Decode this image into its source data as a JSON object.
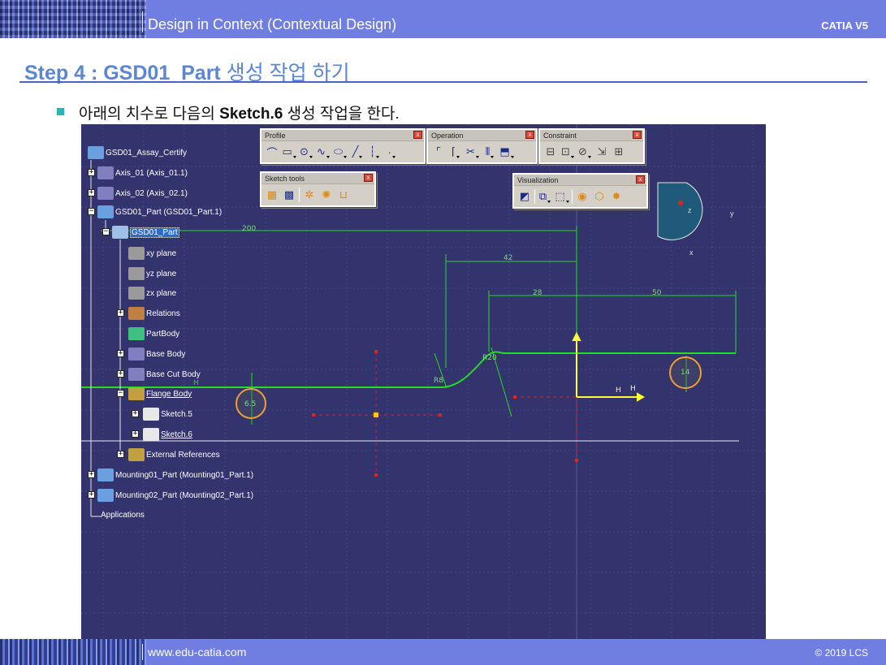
{
  "header": {
    "title": "Design in Context (Contextual Design)",
    "brand": "CATIA V5"
  },
  "step": {
    "prefix": "Step 4 : GSD01_Part ",
    "suffix": "생성 작업 하기"
  },
  "bullet": {
    "text_before": "아래의 치수로 다음의 ",
    "bold": "Sketch.6",
    "text_after": " 생성 작업을 한다."
  },
  "tree": {
    "items": [
      {
        "label": "GSD01_Assay_Certify",
        "icon": "product-icon"
      },
      {
        "label": "Axis_01 (Axis_01.1)",
        "icon": "part-instance-icon"
      },
      {
        "label": "Axis_02 (Axis_02.1)",
        "icon": "part-instance-icon"
      },
      {
        "label": "GSD01_Part (GSD01_Part.1)",
        "icon": "part-instance-icon"
      },
      {
        "label": "GSD01_Part",
        "icon": "part-icon",
        "selected": true
      },
      {
        "label": "xy plane",
        "icon": "plane-icon"
      },
      {
        "label": "yz plane",
        "icon": "plane-icon"
      },
      {
        "label": "zx plane",
        "icon": "plane-icon"
      },
      {
        "label": "Relations",
        "icon": "relations-icon"
      },
      {
        "label": "PartBody",
        "icon": "partbody-icon"
      },
      {
        "label": "Base Body",
        "icon": "geometrical-set-icon"
      },
      {
        "label": "Base Cut Body",
        "icon": "geometrical-set-icon"
      },
      {
        "label": "Flange Body",
        "icon": "geometrical-set-icon",
        "underline": true
      },
      {
        "label": "Sketch.5",
        "icon": "sketch-icon"
      },
      {
        "label": "Sketch.6",
        "icon": "sketch-icon",
        "underline": true
      },
      {
        "label": "External References",
        "icon": "external-references-icon"
      },
      {
        "label": "Mounting01_Part (Mounting01_Part.1)",
        "icon": "part-instance-icon"
      },
      {
        "label": "Mounting02_Part (Mounting02_Part.1)",
        "icon": "part-instance-icon"
      },
      {
        "label": "Applications",
        "icon": ""
      }
    ]
  },
  "toolbars": {
    "profile": {
      "title": "Profile"
    },
    "operation": {
      "title": "Operation"
    },
    "constraint": {
      "title": "Constraint"
    },
    "sketch_tools": {
      "title": "Sketch tools"
    },
    "visualization": {
      "title": "Visualization"
    }
  },
  "dimensions": {
    "d200": "200",
    "d42": "42",
    "d28": "28",
    "d50": "50",
    "r14": "14",
    "r65": "6.5",
    "r8": "R8",
    "r20": "R20"
  },
  "compass": {
    "y": "y",
    "x": "x",
    "z": "z"
  },
  "constraint_labels": {
    "h1": "H",
    "h2": "H",
    "h3": "H"
  },
  "footer": {
    "site": "www.edu-catia.com",
    "copyright": "© 2019 LCS"
  },
  "colors": {
    "banner": "#6f7ee0",
    "viewport": "#33336e",
    "geometry": "#22dd22",
    "constraint": "#f0a030",
    "axis": "#ffff33"
  }
}
